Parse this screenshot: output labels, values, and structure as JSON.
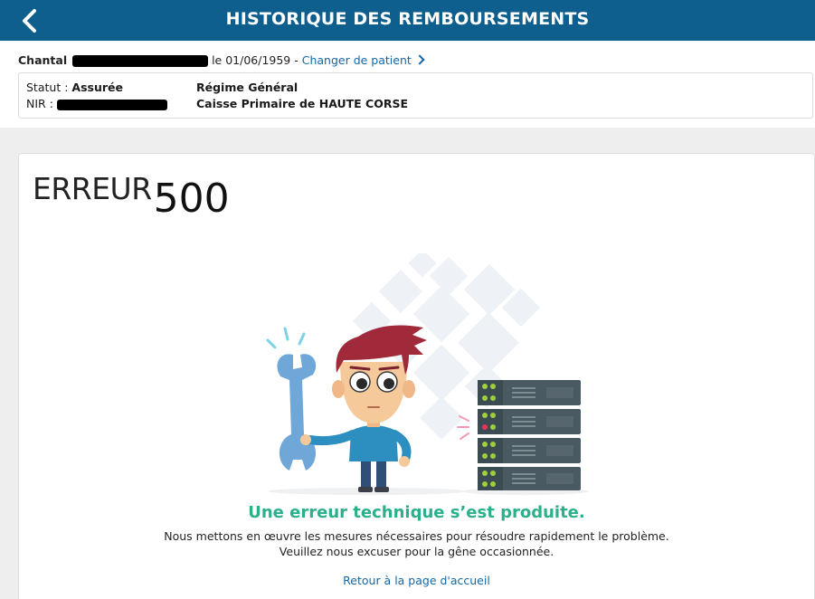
{
  "header": {
    "title": "HISTORIQUE DES REMBOURSEMENTS",
    "back_icon": "chevron-left-icon"
  },
  "patient": {
    "first_name": "Chantal",
    "birth_text": "le 01/06/1959 -",
    "change_link": "Changer de patient",
    "status_label": "Statut :",
    "status_value": "Assurée",
    "nir_label": "NIR :",
    "regime": "Régime Général",
    "caisse": "Caisse Primaire de HAUTE CORSE"
  },
  "error": {
    "word": "ERREUR",
    "code": "500",
    "headline": "Une erreur technique s’est produite.",
    "message_line1": "Nous mettons en œuvre les mesures nécessaires pour résoudre rapidement le problème.",
    "message_line2": "Veuillez nous excuser pour la gêne occasionnée.",
    "home_link": "Retour à la page d'accueil"
  },
  "colors": {
    "header_bg": "#0e5f8e",
    "accent_green": "#2bb08c",
    "link_blue": "#1467a6"
  }
}
